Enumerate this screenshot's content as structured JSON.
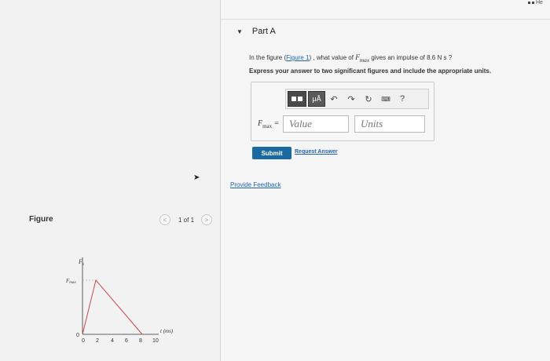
{
  "problem": {
    "part_label": "Part A",
    "question_prefix": "In the figure (",
    "figure_link": "Figure 1",
    "question_mid": ") , what value of ",
    "question_var": "F",
    "question_var_sub": "max",
    "question_suffix": " gives an impulse of 8.6 N s ?",
    "instruction": "Express your answer to two significant figures and include the appropriate units."
  },
  "answer": {
    "label_var": "F",
    "label_sub": "max",
    "label_eq": " =",
    "value_placeholder": "Value",
    "units_placeholder": "Units",
    "toolbar": {
      "mu_label": "μÅ",
      "undo_icon": "↶",
      "redo_icon": "↷",
      "reset_icon": "↻",
      "keyboard_icon": "⌨",
      "help_label": "?"
    }
  },
  "actions": {
    "submit": "Submit",
    "request_answer": "Request Answer",
    "feedback": "Provide Feedback"
  },
  "figure": {
    "title": "Figure",
    "pager_text": "1 of 1",
    "prev": "<",
    "next": ">",
    "axis_y_label": "F",
    "axis_y_sub": "x",
    "fmax_label": "F",
    "fmax_sub": "max",
    "origin": "0",
    "ticks": [
      "0",
      "2",
      "4",
      "6",
      "8",
      "10"
    ],
    "axis_x_label": "t (ms)"
  },
  "corner_badge": "He",
  "colors": {
    "link": "#1f63b8",
    "submit": "#1a6aa1",
    "graph_line": "#c44a4a"
  }
}
